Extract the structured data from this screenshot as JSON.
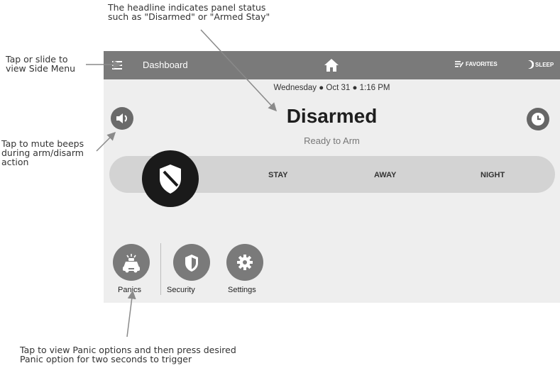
{
  "annotations": {
    "headline_note": "The headline indicates panel status\nsuch as \"Disarmed\" or \"Armed Stay\"",
    "menu_note": "Tap or slide to\nview Side Menu",
    "mute_note": "Tap to mute beeps\nduring arm/disarm\naction",
    "panic_note": "Tap to view Panic options and then press desired\nPanic option for two seconds to trigger"
  },
  "topbar": {
    "title": "Dashboard",
    "favorites_label": "FAVORITES",
    "sleep_label": "SLEEP",
    "icons": [
      "menu-icon",
      "home-icon",
      "favorites-icon",
      "moon-icon"
    ]
  },
  "status": {
    "date": "Wednesday",
    "day": "Oct 31",
    "time": "1:16 PM",
    "headline": "Disarmed",
    "subhead": "Ready to Arm"
  },
  "arm_modes": {
    "stay": "STAY",
    "away": "AWAY",
    "night": "NIGHT",
    "selected_icon": "shield-icon"
  },
  "quick_actions": {
    "panics": "Panics",
    "security": "Security",
    "settings": "Settings"
  },
  "colors": {
    "topbar": "#7a7a7a",
    "screen_bg": "#eeeeee",
    "slider_track": "#d3d3d3",
    "knob": "#1a1a1a"
  }
}
